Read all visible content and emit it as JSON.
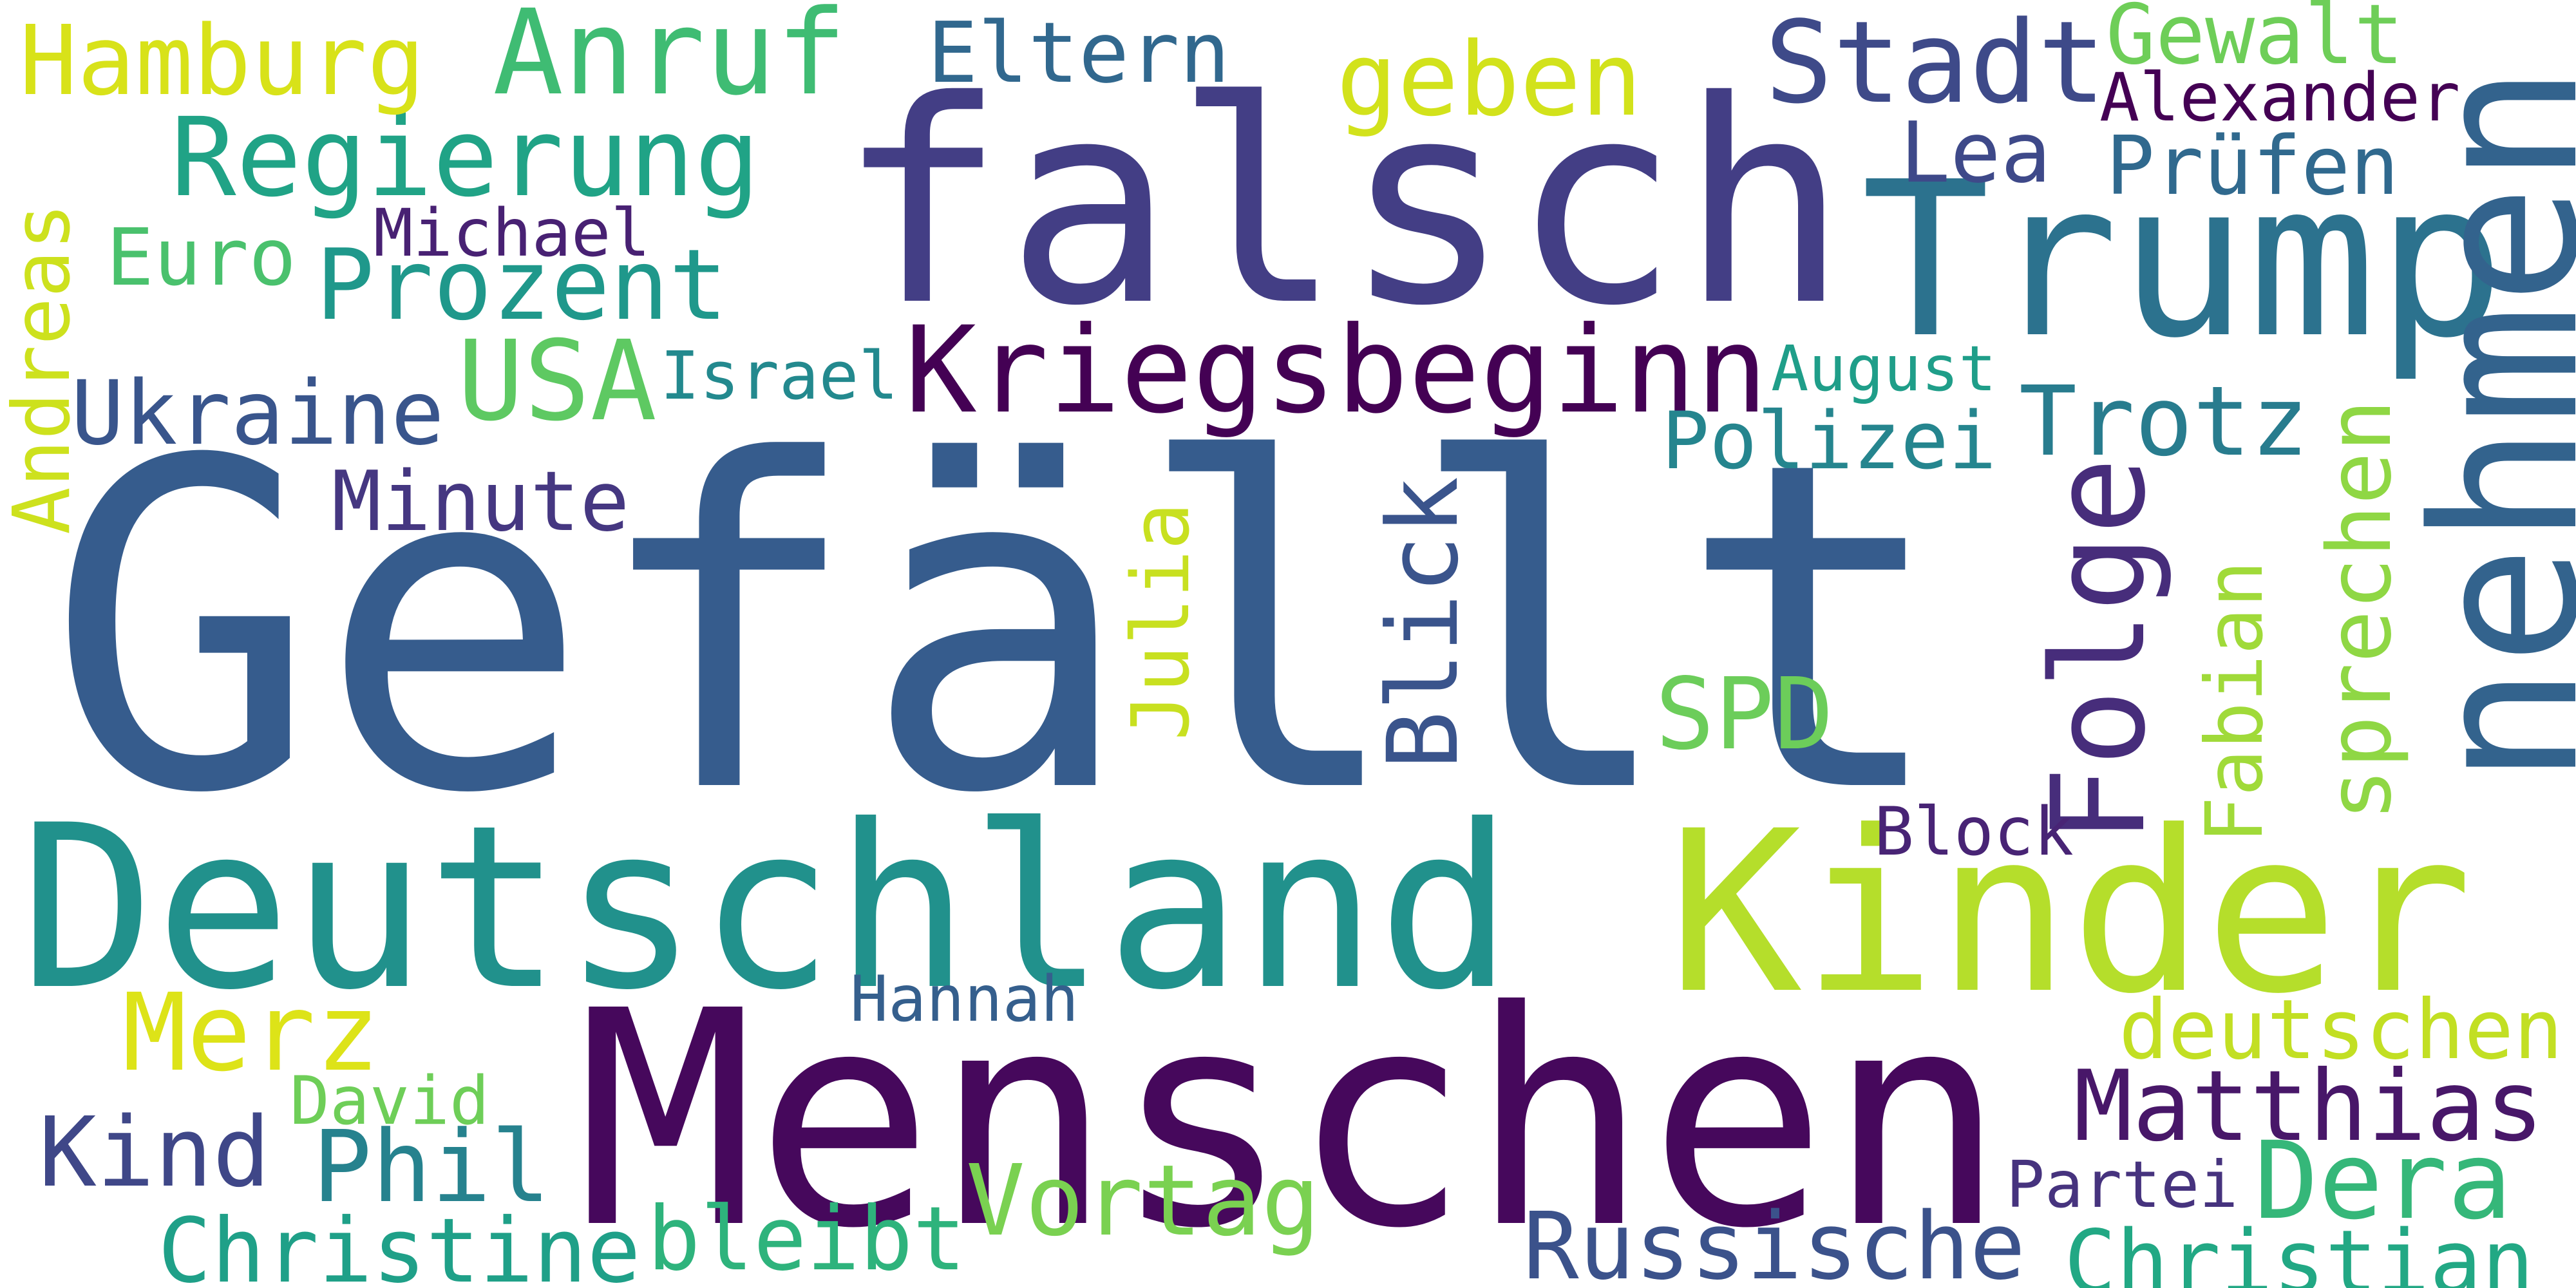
{
  "words": [
    {
      "key": "gefaellt",
      "text": "Gefällt",
      "color": "#365c8d"
    },
    {
      "key": "menschen",
      "text": "Menschen",
      "color": "#46085c"
    },
    {
      "key": "falsch",
      "text": "falsch",
      "color": "#433e85"
    },
    {
      "key": "deutschland",
      "text": "Deutschland",
      "color": "#21918c"
    },
    {
      "key": "kinder",
      "text": "Kinder",
      "color": "#b5de2b"
    },
    {
      "key": "trump",
      "text": "Trump",
      "color": "#2c728e"
    },
    {
      "key": "nehmen",
      "text": "nehmen",
      "color": "#33638d"
    },
    {
      "key": "kriegsbeginn",
      "text": "Kriegsbeginn",
      "color": "#440154"
    },
    {
      "key": "anruf",
      "text": "Anruf",
      "color": "#3fbc73"
    },
    {
      "key": "stadt",
      "text": "Stadt",
      "color": "#3e4a89"
    },
    {
      "key": "regierung",
      "text": "Regierung",
      "color": "#20a386"
    },
    {
      "key": "usa",
      "text": "USA",
      "color": "#5ec962"
    },
    {
      "key": "matthias",
      "text": "Matthias",
      "color": "#481769"
    },
    {
      "key": "prozent",
      "text": "Prozent",
      "color": "#1f988b"
    },
    {
      "key": "hamburg",
      "text": "Hamburg",
      "color": "#d8e219"
    },
    {
      "key": "ukraine",
      "text": "Ukraine",
      "color": "#39558c"
    },
    {
      "key": "trotz",
      "text": "Trotz",
      "color": "#287c8e"
    },
    {
      "key": "folge",
      "text": "Folge",
      "color": "#472d7b"
    },
    {
      "key": "vortag",
      "text": "Vortag",
      "color": "#7ad151"
    },
    {
      "key": "dera",
      "text": "Dera",
      "color": "#35b779"
    },
    {
      "key": "russische",
      "text": "Russische",
      "color": "#3b528b"
    },
    {
      "key": "christian",
      "text": "Christian",
      "color": "#22a884"
    },
    {
      "key": "christine",
      "text": "Christine",
      "color": "#1fa088"
    },
    {
      "key": "phil",
      "text": "Phil",
      "color": "#26828e"
    },
    {
      "key": "geben",
      "text": "geben",
      "color": "#d2e21b"
    },
    {
      "key": "merz",
      "text": "Merz",
      "color": "#dde318"
    },
    {
      "key": "kind",
      "text": "Kind",
      "color": "#3f4788"
    },
    {
      "key": "bleibt",
      "text": "bleibt",
      "color": "#2eb37c"
    },
    {
      "key": "eltern",
      "text": "Eltern",
      "color": "#31688e"
    },
    {
      "key": "minute",
      "text": "Minute",
      "color": "#453781"
    },
    {
      "key": "pruefen",
      "text": "Prüfen",
      "color": "#30698e"
    },
    {
      "key": "gewalt",
      "text": "Gewalt",
      "color": "#6ece58"
    },
    {
      "key": "polizei",
      "text": "Polizei",
      "color": "#25858e"
    },
    {
      "key": "blick",
      "text": "Blick",
      "color": "#3a548c"
    },
    {
      "key": "sprechen",
      "text": "sprechen",
      "color": "#8fd744"
    },
    {
      "key": "deutschen",
      "text": "deutschen",
      "color": "#c2df23"
    },
    {
      "key": "euro",
      "text": "Euro",
      "color": "#4ac16d"
    },
    {
      "key": "spd",
      "text": "SPD",
      "color": "#6ccd5a"
    },
    {
      "key": "andreas",
      "text": "Andreas",
      "color": "#cde11d"
    },
    {
      "key": "israel",
      "text": "Israel",
      "color": "#23898e"
    },
    {
      "key": "fabian",
      "text": "Fabian",
      "color": "#a0da39"
    },
    {
      "key": "julia",
      "text": "Julia",
      "color": "#c8e020"
    },
    {
      "key": "alexander",
      "text": "Alexander",
      "color": "#440154"
    },
    {
      "key": "lea",
      "text": "Lea",
      "color": "#3e4989"
    },
    {
      "key": "august",
      "text": "August",
      "color": "#1f9e89"
    },
    {
      "key": "michael",
      "text": "Michael",
      "color": "#482173"
    },
    {
      "key": "block",
      "text": "Block",
      "color": "#482475"
    },
    {
      "key": "hannah",
      "text": "Hannah",
      "color": "#355f8d"
    },
    {
      "key": "david",
      "text": "David",
      "color": "#6ece58"
    },
    {
      "key": "partei",
      "text": "Partei",
      "color": "#46337e"
    }
  ]
}
